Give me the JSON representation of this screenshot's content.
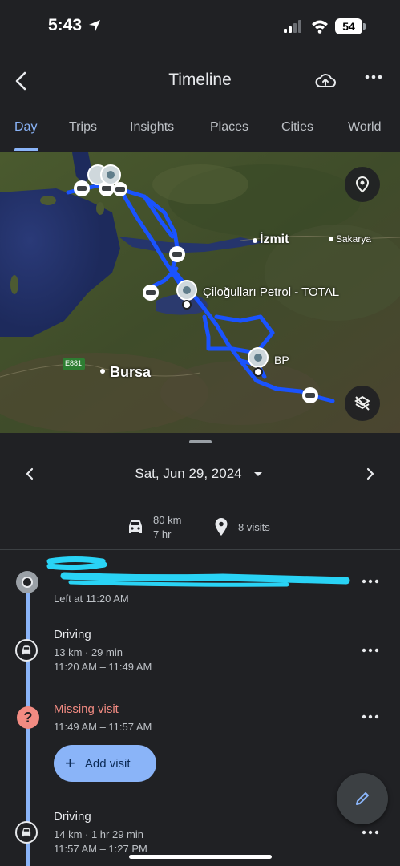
{
  "status_bar": {
    "time": "5:43",
    "battery": "54"
  },
  "header": {
    "title": "Timeline"
  },
  "tabs": [
    {
      "label": "Day",
      "active": true
    },
    {
      "label": "Trips"
    },
    {
      "label": "Insights"
    },
    {
      "label": "Places"
    },
    {
      "label": "Cities"
    },
    {
      "label": "World"
    }
  ],
  "map": {
    "labels": {
      "izmit": "İzmit",
      "sakarya": "Sakarya",
      "petrol": "Çiloğulları Petrol - TOTAL",
      "bp": "BP",
      "bursa": "Bursa",
      "road": "E881"
    },
    "route_color": "#1a53ff"
  },
  "date_nav": {
    "date": "Sat, Jun 29, 2024"
  },
  "summary": {
    "distance": "80 km",
    "duration": "7 hr",
    "visits": "8 visits"
  },
  "timeline": {
    "first_visit": {
      "left_at": "Left at 11:20 AM"
    },
    "driving1": {
      "title": "Driving",
      "stats": "13 km · 29 min",
      "time_range": "11:20 AM – 11:49 AM"
    },
    "missing": {
      "title": "Missing visit",
      "time_range": "11:49 AM – 11:57 AM",
      "button": "Add visit"
    },
    "driving2": {
      "title": "Driving",
      "stats": "14 km · 1 hr 29 min",
      "time_range": "11:57 AM – 1:27 PM"
    }
  },
  "colors": {
    "accent": "#8ab4f8",
    "missing": "#f28b82"
  }
}
